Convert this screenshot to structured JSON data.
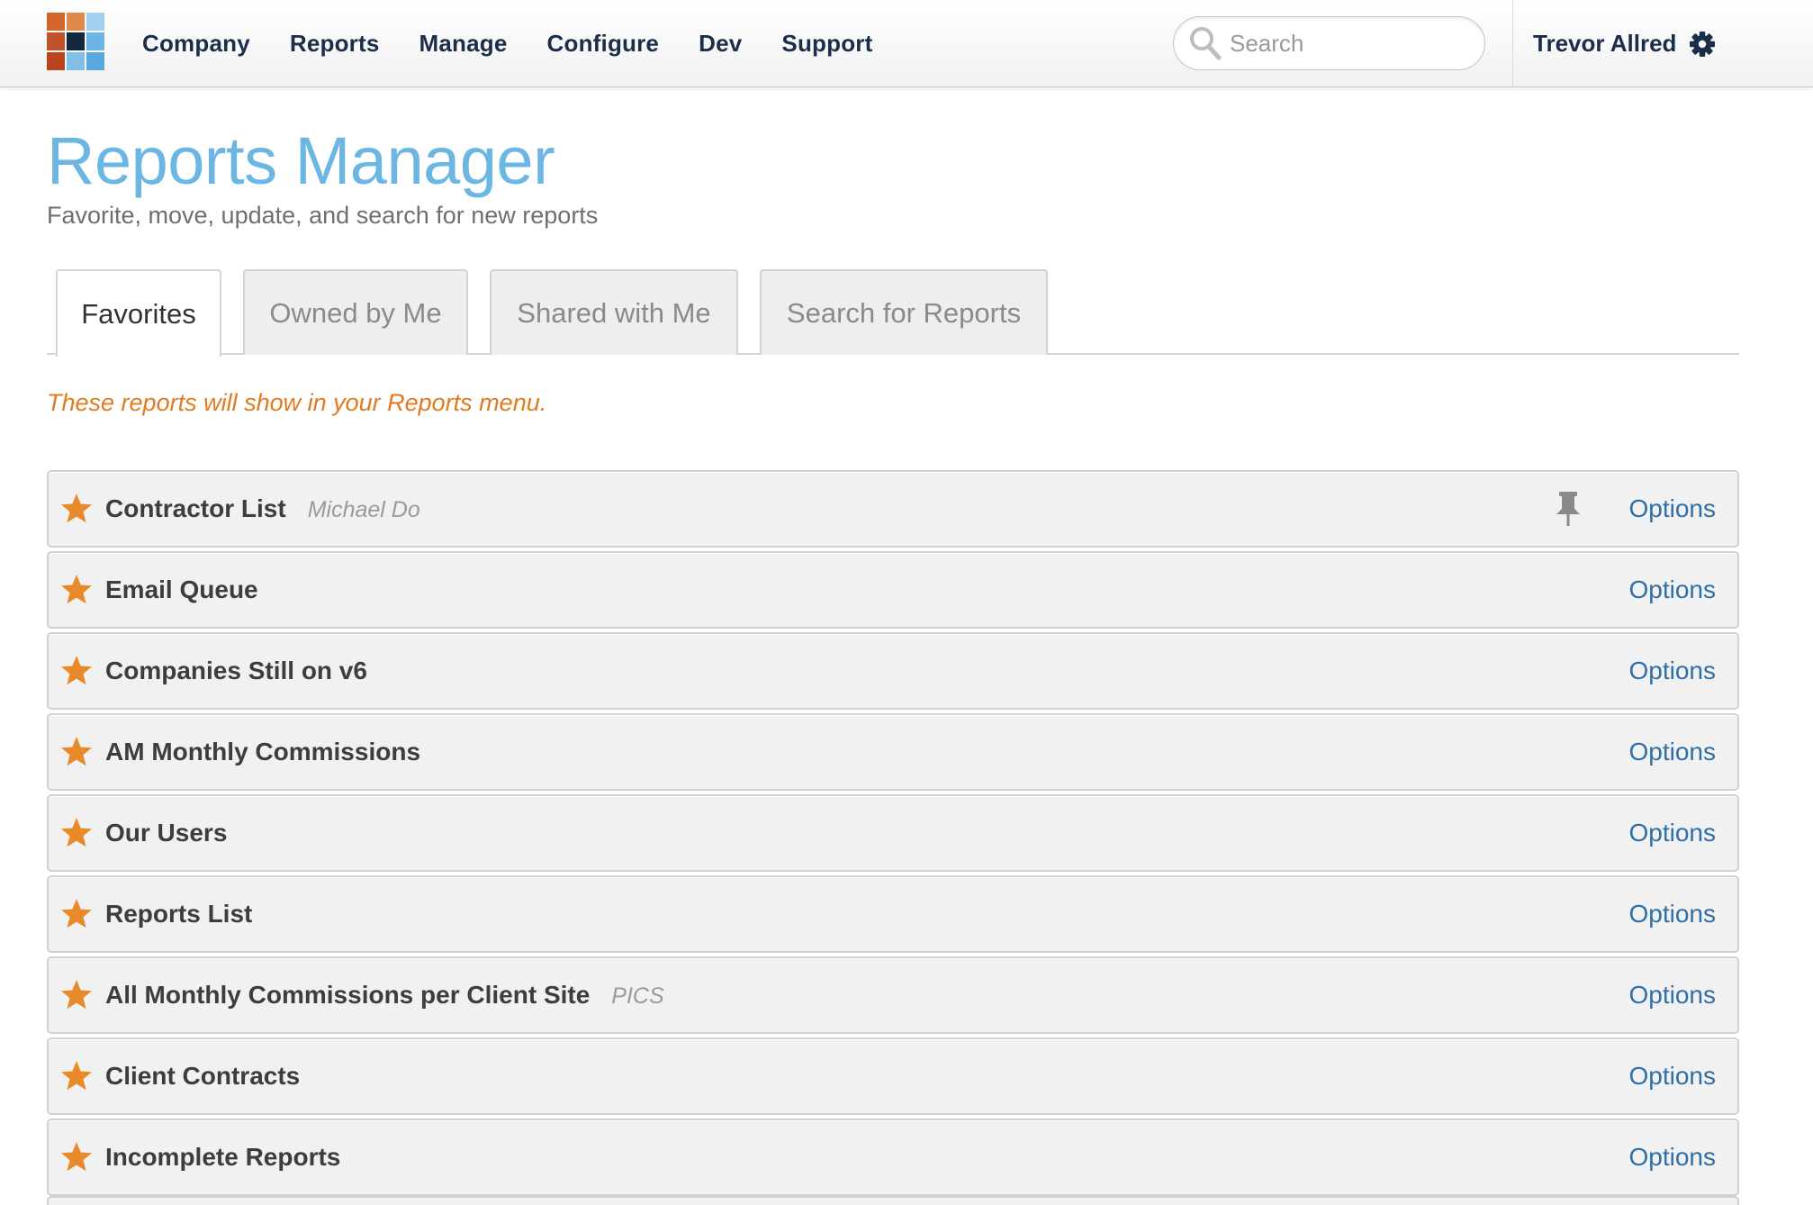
{
  "colors": {
    "title": "#6bb6e3",
    "nav_text": "#1a2e4a",
    "star": "#e98a2a",
    "note": "#e07b1f",
    "link": "#2f6fa8"
  },
  "logo": {
    "tiles": [
      "#d4652a",
      "#e0874a",
      "#9fd0ee",
      "#c1532a",
      "#14283f",
      "#6cb6e6",
      "#b7451f",
      "#7fbfe8",
      "#5ba6dc"
    ]
  },
  "nav": {
    "items": [
      "Company",
      "Reports",
      "Manage",
      "Configure",
      "Dev",
      "Support"
    ]
  },
  "search": {
    "placeholder": "Search",
    "icon": "search-icon"
  },
  "user": {
    "name": "Trevor Allred",
    "icon": "gear-icon"
  },
  "page": {
    "title": "Reports Manager",
    "subtitle": "Favorite, move, update, and search for new reports"
  },
  "tabs": [
    {
      "label": "Favorites",
      "active": true
    },
    {
      "label": "Owned by Me",
      "active": false
    },
    {
      "label": "Shared with Me",
      "active": false
    },
    {
      "label": "Search for Reports",
      "active": false
    }
  ],
  "note": "These reports will show in your Reports menu.",
  "reports": [
    {
      "name": "Contractor List",
      "owner": "Michael Do",
      "pinned": true,
      "options_label": "Options"
    },
    {
      "name": "Email Queue",
      "owner": "",
      "pinned": false,
      "options_label": "Options"
    },
    {
      "name": "Companies Still on v6",
      "owner": "",
      "pinned": false,
      "options_label": "Options"
    },
    {
      "name": "AM Monthly Commissions",
      "owner": "",
      "pinned": false,
      "options_label": "Options"
    },
    {
      "name": "Our Users",
      "owner": "",
      "pinned": false,
      "options_label": "Options"
    },
    {
      "name": "Reports List",
      "owner": "",
      "pinned": false,
      "options_label": "Options"
    },
    {
      "name": "All Monthly Commissions per Client Site",
      "owner": "PICS",
      "pinned": false,
      "options_label": "Options"
    },
    {
      "name": "Client Contracts",
      "owner": "",
      "pinned": false,
      "options_label": "Options"
    },
    {
      "name": "Incomplete Reports",
      "owner": "",
      "pinned": false,
      "options_label": "Options"
    }
  ]
}
